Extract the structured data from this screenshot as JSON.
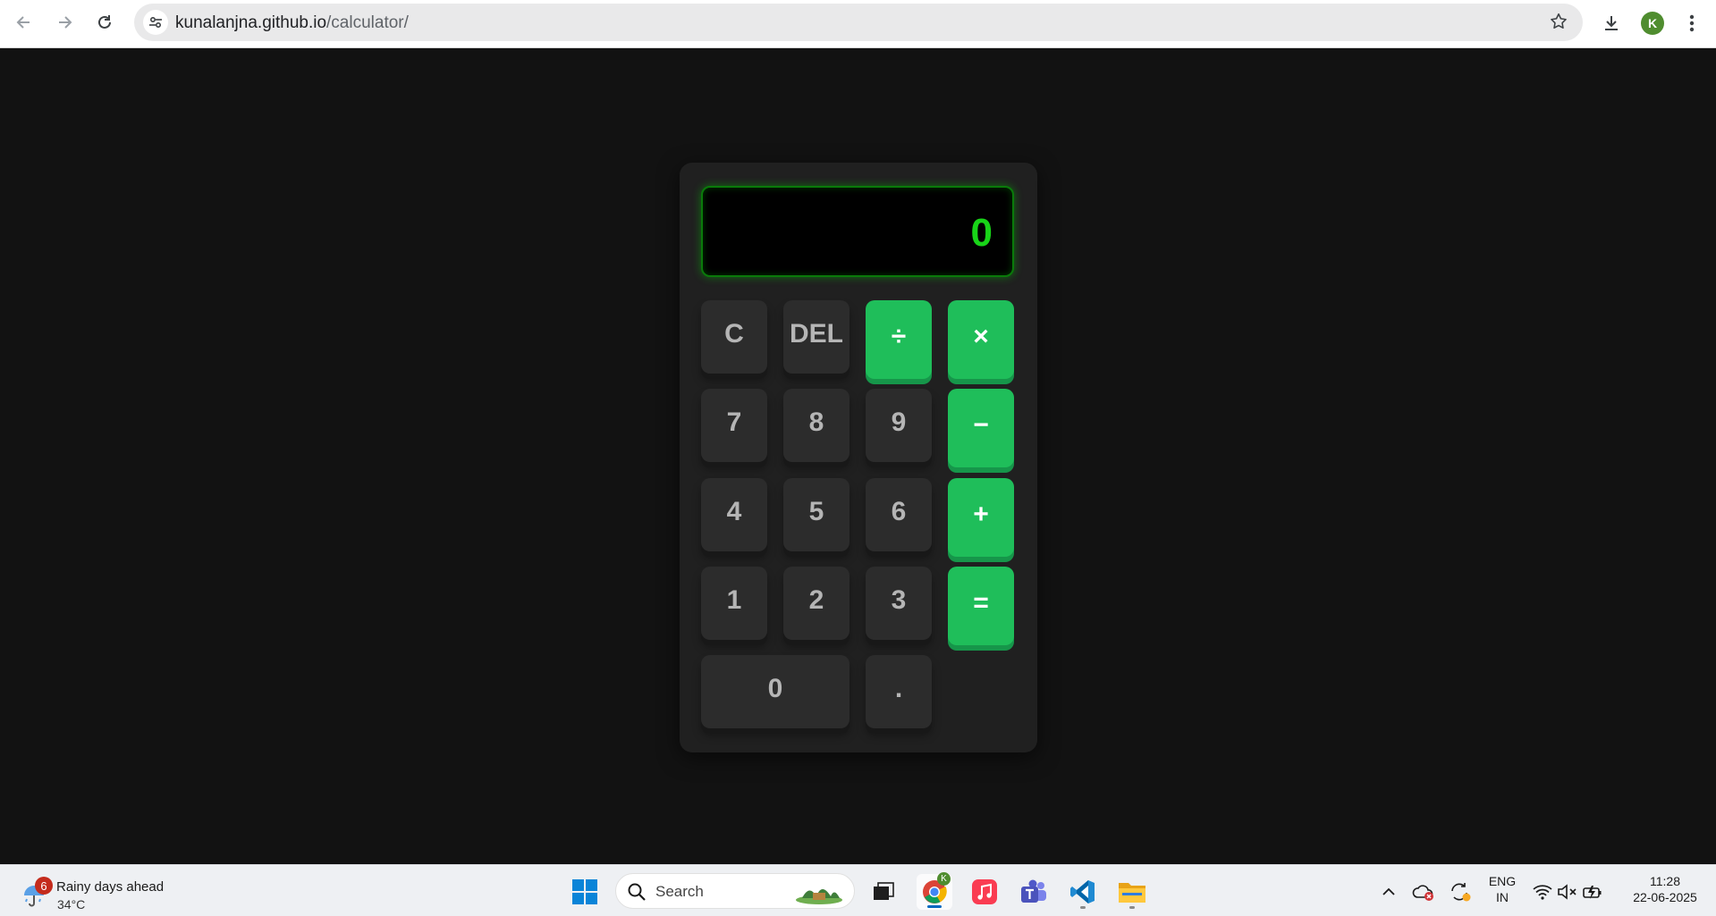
{
  "browser": {
    "url_host": "kunalanjna.github.io",
    "url_path": "/calculator/",
    "profile_initial": "K"
  },
  "calculator": {
    "display": "0",
    "rows": [
      [
        "C",
        "DEL",
        "÷",
        "×"
      ],
      [
        "7",
        "8",
        "9",
        "−"
      ],
      [
        "4",
        "5",
        "6",
        "+"
      ],
      [
        "1",
        "2",
        "3",
        "="
      ],
      [
        "0",
        "."
      ]
    ],
    "colors": {
      "operator": "#1fbe5a",
      "digit": "#2c2c2c",
      "display_text": "#18d418"
    }
  },
  "taskbar": {
    "weather": {
      "badge": "6",
      "title": "Rainy days ahead",
      "temp": "34°C"
    },
    "search_label": "Search",
    "chrome_badge": "K",
    "lang_line1": "ENG",
    "lang_line2": "IN",
    "time": "11:28",
    "date": "22-06-2025"
  }
}
